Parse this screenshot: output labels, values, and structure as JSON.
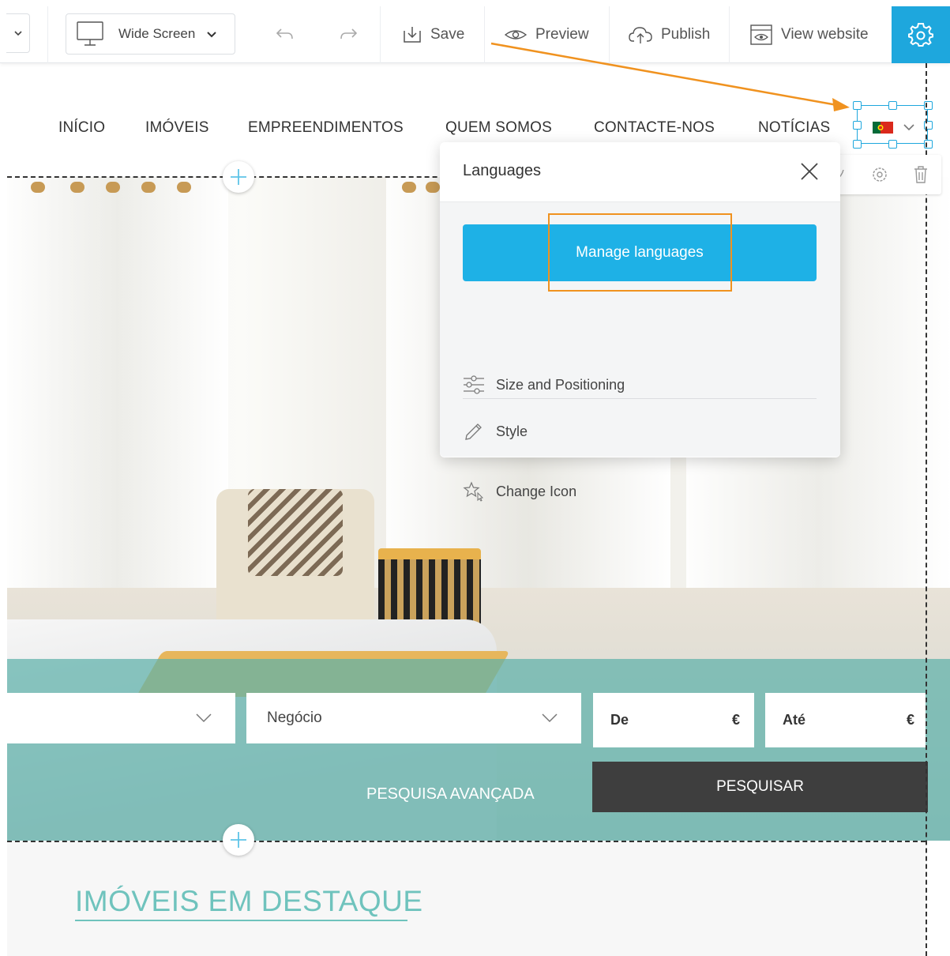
{
  "toolbar": {
    "screen_mode": "Wide Screen",
    "save_label": "Save",
    "preview_label": "Preview",
    "publish_label": "Publish",
    "view_website_label": "View website"
  },
  "nav": {
    "items": [
      "INÍCIO",
      "IMÓVEIS",
      "EMPREENDIMENTOS",
      "QUEM SOMOS",
      "CONTACTE-NOS",
      "NOTÍCIAS"
    ]
  },
  "languages_popover": {
    "title": "Languages",
    "manage_button": "Manage languages",
    "size_positioning": "Size and Positioning",
    "style": "Style",
    "change_icon": "Change Icon"
  },
  "search": {
    "negocio_placeholder": "Negócio",
    "price_from": "De",
    "price_to": "Até",
    "currency": "€",
    "advanced": "PESQUISA AVANÇADA",
    "submit": "PESQUISAR"
  },
  "featured": {
    "title": "IMÓVEIS EM DESTAQUE"
  },
  "colors": {
    "accent_blue": "#1ea7dd",
    "annotation_orange": "#f0921f",
    "teal": "#6fc3bd"
  }
}
